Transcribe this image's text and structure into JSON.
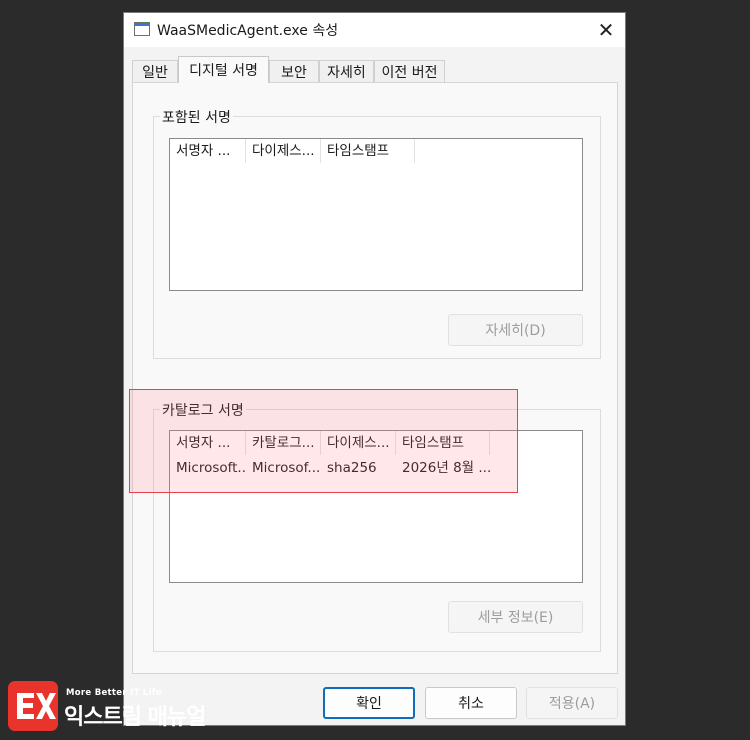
{
  "window": {
    "title": "WaaSMedicAgent.exe 속성",
    "close_glyph": "✕"
  },
  "tabs": [
    {
      "label": "일반",
      "active": false
    },
    {
      "label": "디지털 서명",
      "active": true
    },
    {
      "label": "보안",
      "active": false
    },
    {
      "label": "자세히",
      "active": false
    },
    {
      "label": "이전 버전",
      "active": false
    }
  ],
  "embedded": {
    "legend": "포함된 서명",
    "columns": [
      "서명자 ...",
      "다이제스...",
      "타임스탬프"
    ],
    "details_button": "자세히(D)"
  },
  "catalog": {
    "legend": "카탈로그 서명",
    "columns": [
      "서명자 ...",
      "카탈로그...",
      "다이제스...",
      "타임스탬프"
    ],
    "rows": [
      [
        "Microsoft...",
        "Microsof...",
        "sha256",
        "2026년 8월 ..."
      ]
    ],
    "details_button": "세부 정보(E)"
  },
  "footer": {
    "ok": "확인",
    "cancel": "취소",
    "apply": "적용(A)"
  },
  "watermark": {
    "tagline": "More Better IT Life",
    "name": "익스트림 매뉴얼"
  },
  "colors": {
    "highlight_border": "#e8414d",
    "default_button_border": "#0f6cbd",
    "logo": "#e8342c"
  }
}
